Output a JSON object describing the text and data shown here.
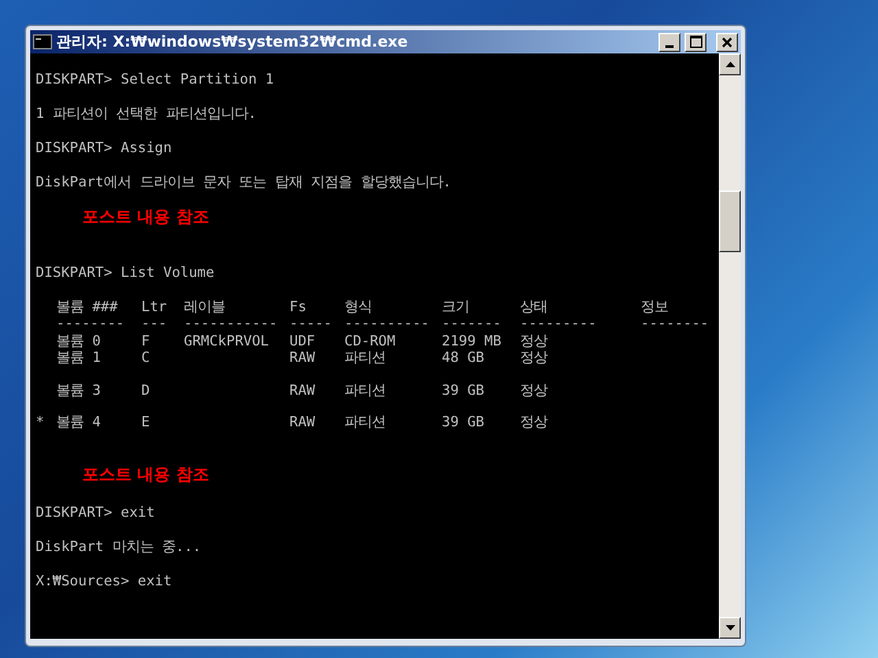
{
  "window": {
    "title": "관리자: X:₩windows₩system32₩cmd.exe"
  },
  "console": [
    {
      "kind": "blank"
    },
    {
      "kind": "text",
      "text": "DISKPART> Select Partition 1"
    },
    {
      "kind": "blank"
    },
    {
      "kind": "text",
      "text": "1 파티션이 선택한 파티션입니다."
    },
    {
      "kind": "blank"
    },
    {
      "kind": "text",
      "text": "DISKPART> Assign"
    },
    {
      "kind": "blank"
    },
    {
      "kind": "text",
      "text": "DiskPart에서 드라이브 문자 또는 탑재 지점을 할당했습니다."
    },
    {
      "kind": "blank"
    },
    {
      "kind": "note",
      "text": "포스트 내용 참조"
    },
    {
      "kind": "blank"
    },
    {
      "kind": "blank"
    },
    {
      "kind": "text",
      "text": "DISKPART> List Volume"
    },
    {
      "kind": "blank"
    },
    {
      "kind": "table",
      "columns": [
        "볼륨 ###",
        "Ltr",
        "레이블",
        "Fs",
        "형식",
        "크기",
        "상태",
        "정보"
      ],
      "separators": [
        "--------",
        "---",
        "-----------",
        "-----",
        "----------",
        "-------",
        "---------",
        "--------"
      ],
      "rows": [
        {
          "kind": "volume",
          "marker": "",
          "cells": [
            "볼륨 0",
            "F",
            "GRMCkPRVOL",
            "UDF",
            "CD-ROM",
            "2199 MB",
            "정상"
          ]
        },
        {
          "kind": "volume",
          "marker": "",
          "cells": [
            "볼륨 1",
            "C",
            "",
            "RAW",
            "파티션",
            "48 GB",
            "정상"
          ]
        },
        {
          "kind": "blank"
        },
        {
          "kind": "volume",
          "marker": "",
          "cells": [
            "볼륨 3",
            "D",
            "",
            "RAW",
            "파티션",
            "39 GB",
            "정상"
          ]
        },
        {
          "kind": "blank"
        },
        {
          "kind": "volume",
          "marker": "*",
          "cells": [
            "볼륨 4",
            "E",
            "",
            "RAW",
            "파티션",
            "39 GB",
            "정상"
          ]
        }
      ]
    },
    {
      "kind": "blank"
    },
    {
      "kind": "blank"
    },
    {
      "kind": "note",
      "text": "포스트 내용 참조"
    },
    {
      "kind": "blank"
    },
    {
      "kind": "text",
      "text": "DISKPART> exit"
    },
    {
      "kind": "blank"
    },
    {
      "kind": "text",
      "text": "DiskPart 마치는 중..."
    },
    {
      "kind": "blank"
    },
    {
      "kind": "text",
      "text": "X:₩Sources> exit"
    }
  ]
}
